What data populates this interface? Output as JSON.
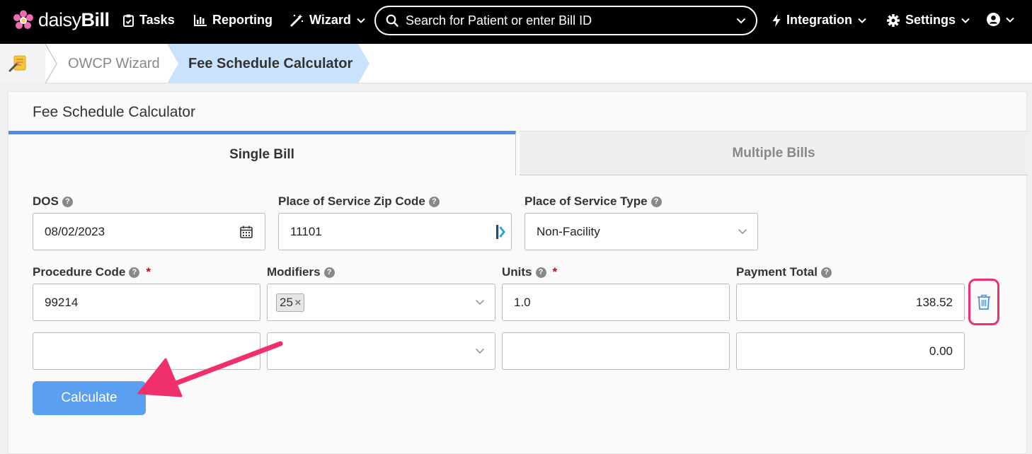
{
  "nav": {
    "logo_daisy": "daisy",
    "logo_bill": "Bill",
    "tasks": "Tasks",
    "reporting": "Reporting",
    "wizard": "Wizard",
    "search_placeholder": "Search for Patient or enter Bill ID",
    "integration": "Integration",
    "settings": "Settings"
  },
  "breadcrumb": {
    "items": [
      "OWCP Wizard",
      "Fee Schedule Calculator"
    ]
  },
  "card": {
    "title": "Fee Schedule Calculator",
    "tabs": [
      {
        "label": "Single Bill",
        "active": true
      },
      {
        "label": "Multiple Bills",
        "active": false
      }
    ]
  },
  "form": {
    "dos_label": "DOS",
    "dos_value": "08/02/2023",
    "zip_label": "Place of Service Zip Code",
    "zip_value": "11101",
    "pos_type_label": "Place of Service Type",
    "pos_type_value": "Non-Facility",
    "procedure_label": "Procedure Code",
    "modifiers_label": "Modifiers",
    "units_label": "Units",
    "payment_label": "Payment Total",
    "required_mark": "*",
    "rows": [
      {
        "procedure": "99214",
        "modifier": "25",
        "units": "1.0",
        "payment": "138.52"
      },
      {
        "procedure": "",
        "modifier": "",
        "units": "",
        "payment": "0.00"
      }
    ],
    "calculate_label": "Calculate"
  },
  "colors": {
    "accent": "#4a90e2",
    "button": "#5a9ff0",
    "annotation": "#f0306a"
  }
}
